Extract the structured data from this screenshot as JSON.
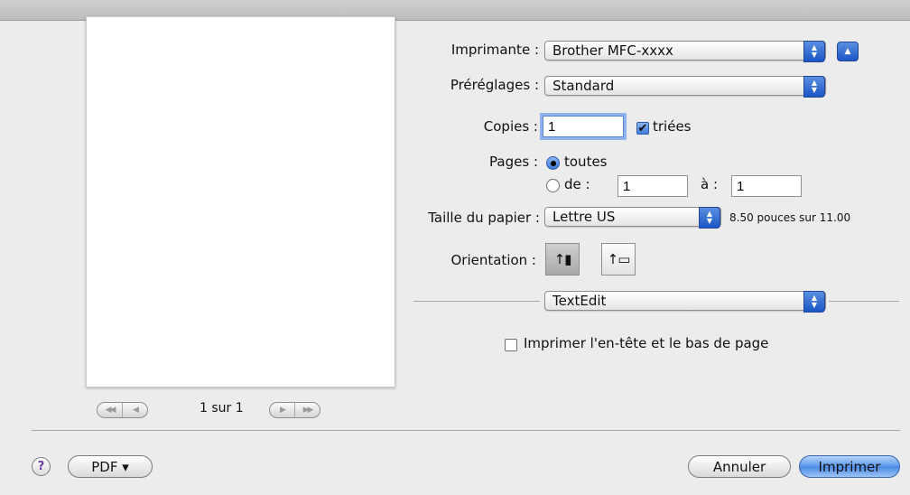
{
  "preview": {
    "page_count": "1 sur 1",
    "nav_first": "◀◀",
    "nav_prev": "◀",
    "nav_next": "▶",
    "nav_last": "▶▶"
  },
  "printer": {
    "label": "Imprimante :",
    "value": "Brother MFC-xxxx"
  },
  "presets": {
    "label": "Préréglages :",
    "value": "Standard"
  },
  "copies": {
    "label": "Copies :",
    "value": "1",
    "collate_label": "triées",
    "collate_checked": true
  },
  "pages": {
    "label": "Pages :",
    "all_label": "toutes",
    "from_label": "de :",
    "from_value": "1",
    "to_label": "à :",
    "to_value": "1",
    "selected": "all"
  },
  "paper": {
    "label": "Taille du papier :",
    "value": "Lettre US",
    "size_text": "8.50 pouces sur 11.00"
  },
  "orientation": {
    "label": "Orientation :",
    "selected": "portrait",
    "portrait_icon": "portrait-orientation-icon",
    "landscape_icon": "landscape-orientation-icon"
  },
  "section": {
    "value": "TextEdit"
  },
  "header_footer": {
    "label": "Imprimer l'en-tête et le bas de page",
    "checked": false
  },
  "footer": {
    "help_glyph": "?",
    "pdf_label": "PDF ▾",
    "cancel_label": "Annuler",
    "print_label": "Imprimer"
  },
  "colors": {
    "accent": "#3f7ad8",
    "dialog_bg": "#ececec",
    "help_glyph": "#6b3aa0"
  }
}
